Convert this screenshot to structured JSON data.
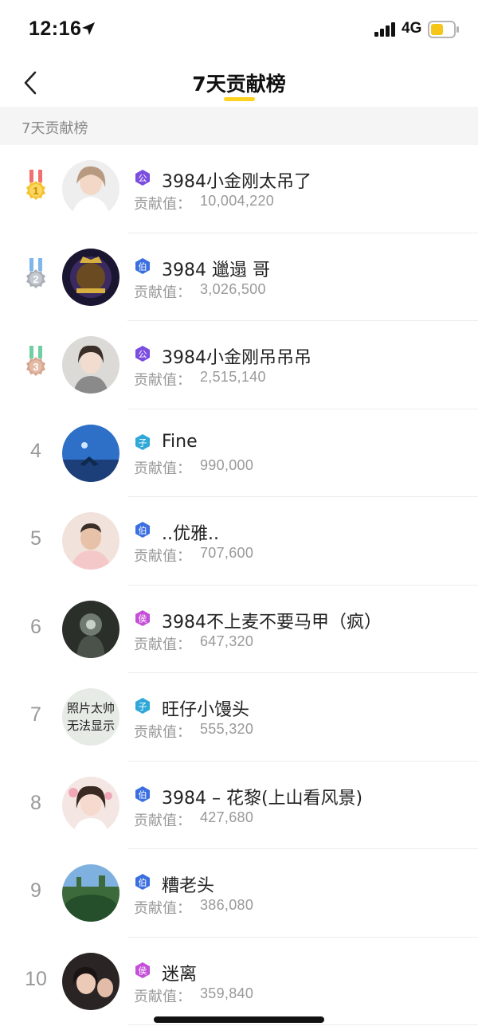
{
  "status": {
    "time": "12:16",
    "network": "4G",
    "battery_color": "#f5c518"
  },
  "nav": {
    "title": "7天贡献榜",
    "back_icon": "chevron-left-icon",
    "accent": "#ffd21f"
  },
  "section": {
    "title": "7天贡献榜"
  },
  "contrib_label": "贡献值：",
  "rows": [
    {
      "rank": "1",
      "medal": "gold",
      "badge": "公",
      "badge_color": "#7b4ee0",
      "name": "3984小金刚太吊了",
      "value": "10,004,220"
    },
    {
      "rank": "2",
      "medal": "silver",
      "badge": "伯",
      "badge_color": "#3b6fe0",
      "name": "3984 邋遢 哥",
      "value": "3,026,500"
    },
    {
      "rank": "3",
      "medal": "bronze",
      "badge": "公",
      "badge_color": "#7b4ee0",
      "name": "3984小金刚吊吊吊",
      "value": "2,515,140"
    },
    {
      "rank": "4",
      "medal": "",
      "badge": "子",
      "badge_color": "#2fa8d8",
      "name": "Fine",
      "value": "990,000"
    },
    {
      "rank": "5",
      "medal": "",
      "badge": "伯",
      "badge_color": "#3b6fe0",
      "name": "..优雅..",
      "value": "707,600"
    },
    {
      "rank": "6",
      "medal": "",
      "badge": "侯",
      "badge_color": "#c44fd8",
      "name": "3984不上麦不要马甲（疯）",
      "value": "647,320"
    },
    {
      "rank": "7",
      "medal": "",
      "badge": "子",
      "badge_color": "#2fa8d8",
      "name": "旺仔小馒头",
      "value": "555,320"
    },
    {
      "rank": "8",
      "medal": "",
      "badge": "伯",
      "badge_color": "#3b6fe0",
      "name": "3984 – 花黎(上山看风景)",
      "value": "427,680"
    },
    {
      "rank": "9",
      "medal": "",
      "badge": "伯",
      "badge_color": "#3b6fe0",
      "name": "糟老头",
      "value": "386,080"
    },
    {
      "rank": "10",
      "medal": "",
      "badge": "侯",
      "badge_color": "#c44fd8",
      "name": "迷离",
      "value": "359,840"
    }
  ],
  "avatar_placeholder": {
    "line1": "照片太帅",
    "line2": "无法显示"
  }
}
